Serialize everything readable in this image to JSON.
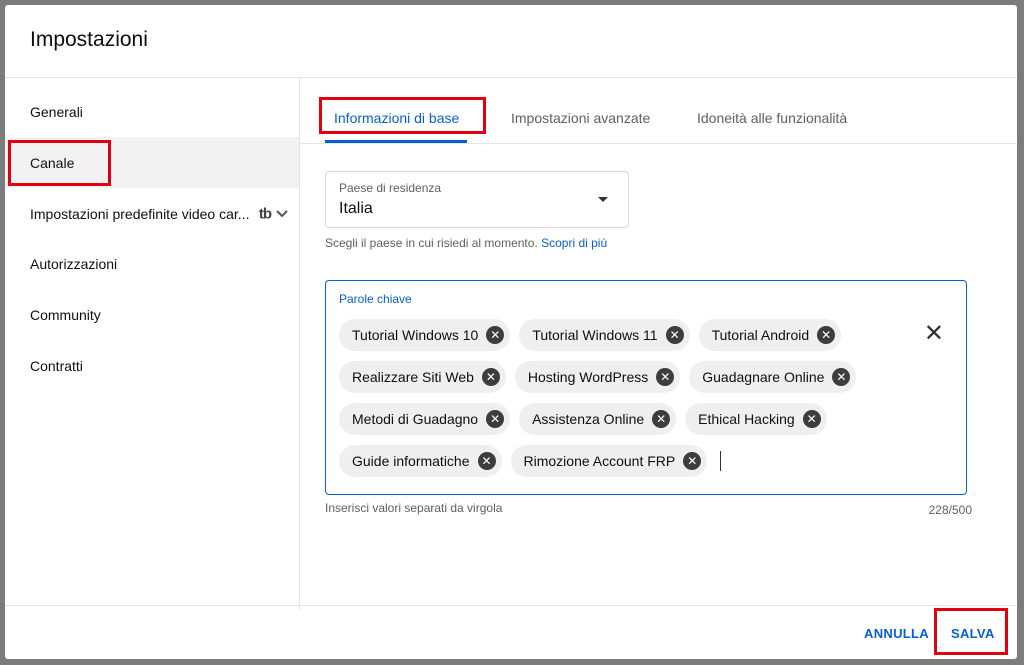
{
  "dialog": {
    "title": "Impostazioni"
  },
  "sidebar": {
    "items": [
      {
        "label": "Generali"
      },
      {
        "label": "Canale"
      },
      {
        "label": "Impostazioni predefinite video car..."
      },
      {
        "label": "Autorizzazioni"
      },
      {
        "label": "Community"
      },
      {
        "label": "Contratti"
      }
    ],
    "tb_icon_text": "tb"
  },
  "tabs": [
    {
      "label": "Informazioni di base"
    },
    {
      "label": "Impostazioni avanzate"
    },
    {
      "label": "Idoneità alle funzionalità"
    }
  ],
  "country": {
    "label": "Paese di residenza",
    "value": "Italia",
    "helper": "Scegli il paese in cui risiedi al momento.",
    "helper_link": "Scopri di più"
  },
  "keywords": {
    "label": "Parole chiave",
    "rows": [
      [
        "Tutorial Windows 10",
        "Tutorial Windows 11",
        "Tutorial Android"
      ],
      [
        "Realizzare Siti Web",
        "Hosting WordPress",
        "Guadagnare Online"
      ],
      [
        "Metodi di Guadagno",
        "Assistenza Online",
        "Ethical Hacking"
      ],
      [
        "Guide informatiche",
        "Rimozione Account FRP"
      ]
    ],
    "helper": "Inserisci valori separati da virgola",
    "count": "228/500"
  },
  "footer": {
    "cancel": "ANNULLA",
    "save": "SALVA"
  },
  "colors": {
    "accent": "#065fd4",
    "highlight": "#e00011"
  }
}
